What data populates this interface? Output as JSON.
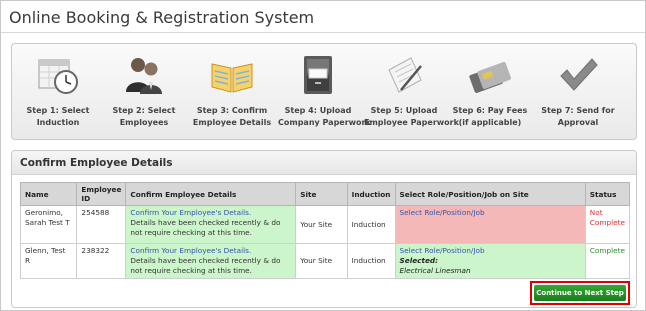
{
  "app": {
    "title": "Online Booking & Registration System"
  },
  "steps": [
    {
      "line1": "Step 1: Select",
      "line2": "Induction",
      "icon": "calendar-clock-icon"
    },
    {
      "line1": "Step 2: Select",
      "line2": "Employees",
      "icon": "people-icon"
    },
    {
      "line1": "Step 3: Confirm",
      "line2": "Employee Details",
      "icon": "open-book-icon"
    },
    {
      "line1": "Step 4: Upload",
      "line2": "Company Paperwork",
      "icon": "file-cabinet-icon"
    },
    {
      "line1": "Step 5: Upload",
      "line2": "Employee Paperwork",
      "icon": "paper-pen-icon"
    },
    {
      "line1": "Step 6: Pay Fees",
      "line2": "(if applicable)",
      "icon": "credit-cards-icon"
    },
    {
      "line1": "Step 7: Send for",
      "line2": "Approval",
      "icon": "checkmark-icon"
    }
  ],
  "panel": {
    "title": "Confirm Employee Details"
  },
  "table": {
    "headers": [
      "Name",
      "Employee ID",
      "Confirm Employee Details",
      "Site",
      "Induction",
      "Select Role/Position/Job on Site",
      "Status"
    ],
    "rows": [
      {
        "name": "Geronimo, Sarah Test T",
        "id": "254588",
        "confirm_link": "Confirm Your Employee's Details.",
        "confirm_note": "Details have been checked recently & do not require checking at this time.",
        "site": "Your Site",
        "induction": "Induction",
        "role_link": "Select Role/Position/Job",
        "selected_label": "",
        "selected_value": "",
        "status": "Not Complete"
      },
      {
        "name": "Glenn, Test R",
        "id": "238322",
        "confirm_link": "Confirm Your Employee's Details.",
        "confirm_note": "Details have been checked recently & do not require checking at this time.",
        "site": "Your Site",
        "induction": "Induction",
        "role_link": "Select Role/Position/Job",
        "selected_label": "Selected:",
        "selected_value": "Electrical Linesman",
        "status": "Complete"
      }
    ]
  },
  "actions": {
    "continue_label": "Continue to Next Step"
  },
  "colors": {
    "accent_green": "#1f8a1f",
    "not_complete": "#d63333",
    "complete": "#2f8f2f",
    "highlight_red": "#e00000"
  }
}
